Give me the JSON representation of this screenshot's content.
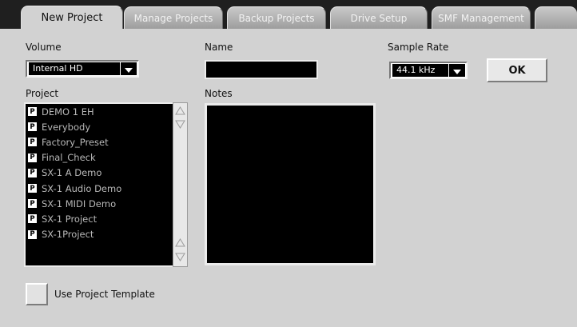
{
  "tabs": [
    {
      "label": "New Project",
      "active": true
    },
    {
      "label": "Manage Projects",
      "active": false
    },
    {
      "label": "Backup Projects",
      "active": false
    },
    {
      "label": "Drive Setup",
      "active": false
    },
    {
      "label": "SMF Management",
      "active": false
    }
  ],
  "volume": {
    "label": "Volume",
    "value": "Internal HD"
  },
  "name": {
    "label": "Name",
    "value": ""
  },
  "sample_rate": {
    "label": "Sample Rate",
    "value": "44.1 kHz"
  },
  "ok_label": "OK",
  "project_list": {
    "label": "Project",
    "icon_letter": "P",
    "items": [
      "DEMO 1 EH",
      "Everybody",
      "Factory_Preset",
      "Final_Check",
      "SX-1 A Demo",
      "SX-1 Audio Demo",
      "SX-1 MIDI Demo",
      "SX-1 Project",
      "SX-1Project"
    ]
  },
  "notes": {
    "label": "Notes",
    "value": ""
  },
  "use_template": {
    "label": "Use Project Template",
    "checked": false
  },
  "colors": {
    "background": "#d2d2d2",
    "field": "#000000",
    "tab_bar": "#1f1f1f"
  }
}
